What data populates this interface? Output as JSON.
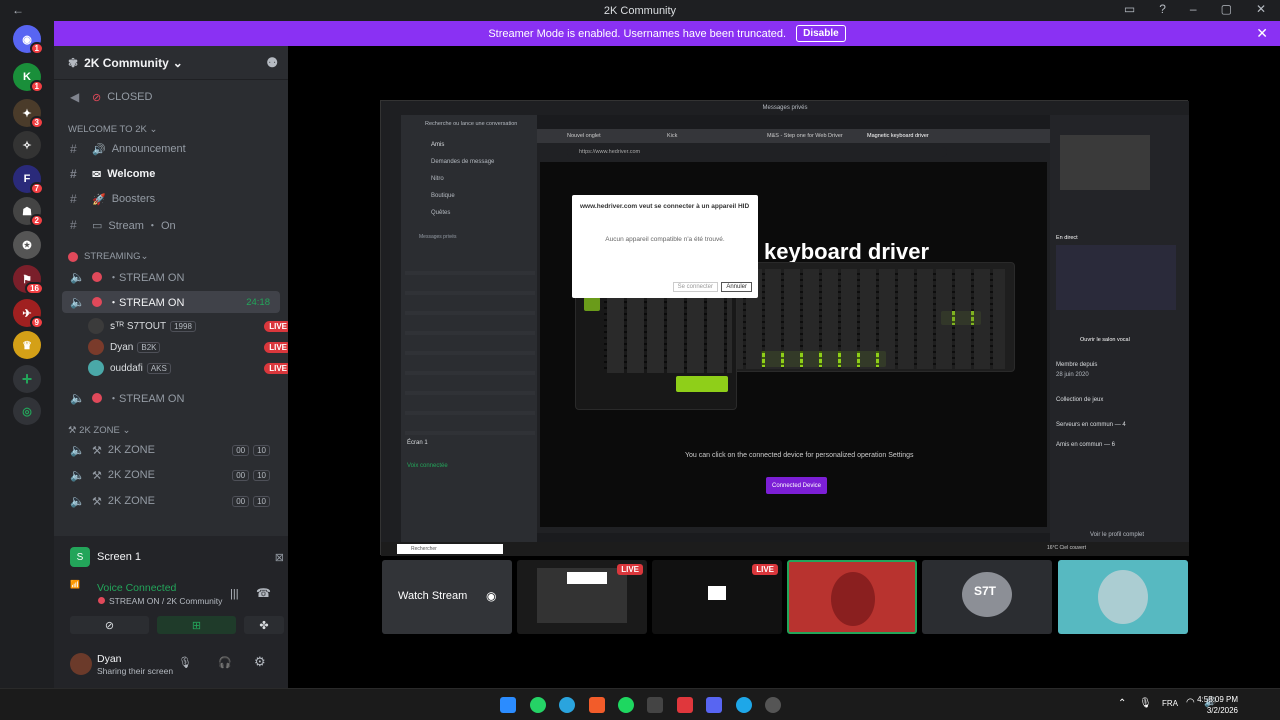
{
  "window": {
    "title": "2K Community"
  },
  "banner": {
    "text": "Streamer Mode is enabled. Usernames have been truncated.",
    "button": "Disable"
  },
  "guild": {
    "name": "2K Community"
  },
  "channels": {
    "closed": "CLOSED",
    "cat_welcome": "Welcome To 2K",
    "announcement": "Announcement",
    "welcome": "Welcome",
    "boosters": "Boosters",
    "stream_on_text": "Stream ・ On",
    "cat_streaming": "STREAMING",
    "stream_on_1": "・STREAM ON",
    "stream_on_2": "・STREAM ON",
    "stream_timer": "24:18",
    "stream_on_3": "・STREAM ON",
    "cat_2kzone": "2K ZONE",
    "zone_1": "2K ZONE",
    "zone_2": "2K ZONE",
    "zone_3": "2K ZONE",
    "zone_count": "00",
    "zone_limit": "10"
  },
  "voice_users": [
    {
      "name": "ꜱᵀᴿ S7TOUT",
      "tag": "1998",
      "live": "LIVE"
    },
    {
      "name": "Dyan",
      "tag": "B2K",
      "live": "LIVE"
    },
    {
      "name": "ouddafi",
      "tag": "AKS",
      "live": "LIVE"
    }
  ],
  "panel": {
    "screen_title": "Screen 1",
    "voice_connected": "Voice Connected",
    "voice_channel": "STREAM ON / 2K Community",
    "username": "Dyan",
    "status": "Sharing their screen"
  },
  "stream": {
    "page_title": "keyboard driver",
    "dialog_title": "www.hedriver.com veut se connecter à un appareil HID",
    "dialog_body": "Aucun appareil compatible n'a été trouvé.",
    "dialog_connect": "Se connecter",
    "dialog_cancel": "Annuler",
    "hint": "You can click on the connected device for personalized operation Settings",
    "connected_btn": "Connected Device",
    "url": "https://www.hedriver.com",
    "tab_active": "Magnetic keyboard driver",
    "tab_1": "Nouvel onglet",
    "tab_2": "Kick",
    "tab_3": "M&S - Step one for Web Driver",
    "msg_title": "Messages privés",
    "search": "Recherche ou lance une conversation",
    "friends": "Amis",
    "requests": "Demandes de message",
    "nitro": "Nitro",
    "shop": "Boutique",
    "quests": "Quêtes",
    "dm_header": "Messages privés",
    "right_live": "En direct",
    "open_voice": "Ouvrir le salon vocal",
    "member_since": "Membre depuis",
    "date": "28 juin 2020",
    "games": "Collection de jeux",
    "common_servers": "Serveurs en commun — 4",
    "common_friends": "Amis en commun — 6",
    "full_profile": "Voir le profil complet",
    "screen_label": "Écran 1",
    "voice_label": "Voix connectée",
    "taskbar_search": "Rechercher",
    "weather": "16°C Ciel couvert"
  },
  "thumbnails": {
    "watch": "Watch Stream",
    "live": "LIVE",
    "live2": "LIVE",
    "user_tag": "S7T"
  },
  "taskbar": {
    "time": "4:58:09 PM",
    "date": "3/2/2026",
    "lang": "FRA"
  }
}
